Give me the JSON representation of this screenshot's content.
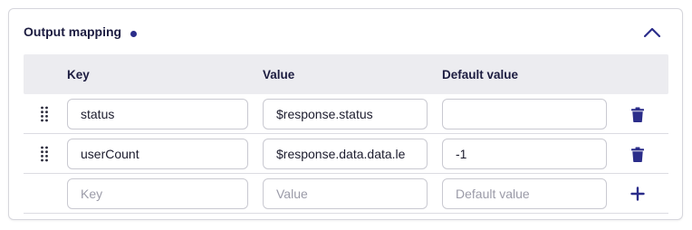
{
  "section": {
    "title": "Output mapping"
  },
  "table": {
    "headers": {
      "key": "Key",
      "value": "Value",
      "default": "Default value"
    },
    "rows": [
      {
        "key": "status",
        "value": "$response.status",
        "default": ""
      },
      {
        "key": "userCount",
        "value": "$response.data.data.le",
        "default": "-1"
      }
    ],
    "new_row": {
      "key_placeholder": "Key",
      "value_placeholder": "Value",
      "default_placeholder": "Default value"
    }
  },
  "icons": {
    "collapse": "chevron-up-icon",
    "drag": "drag-handle-icon",
    "delete": "trash-icon",
    "add": "plus-icon"
  },
  "colors": {
    "accent": "#2b2d8a",
    "header_bg": "#ececf0",
    "border": "#c9c9d1"
  }
}
